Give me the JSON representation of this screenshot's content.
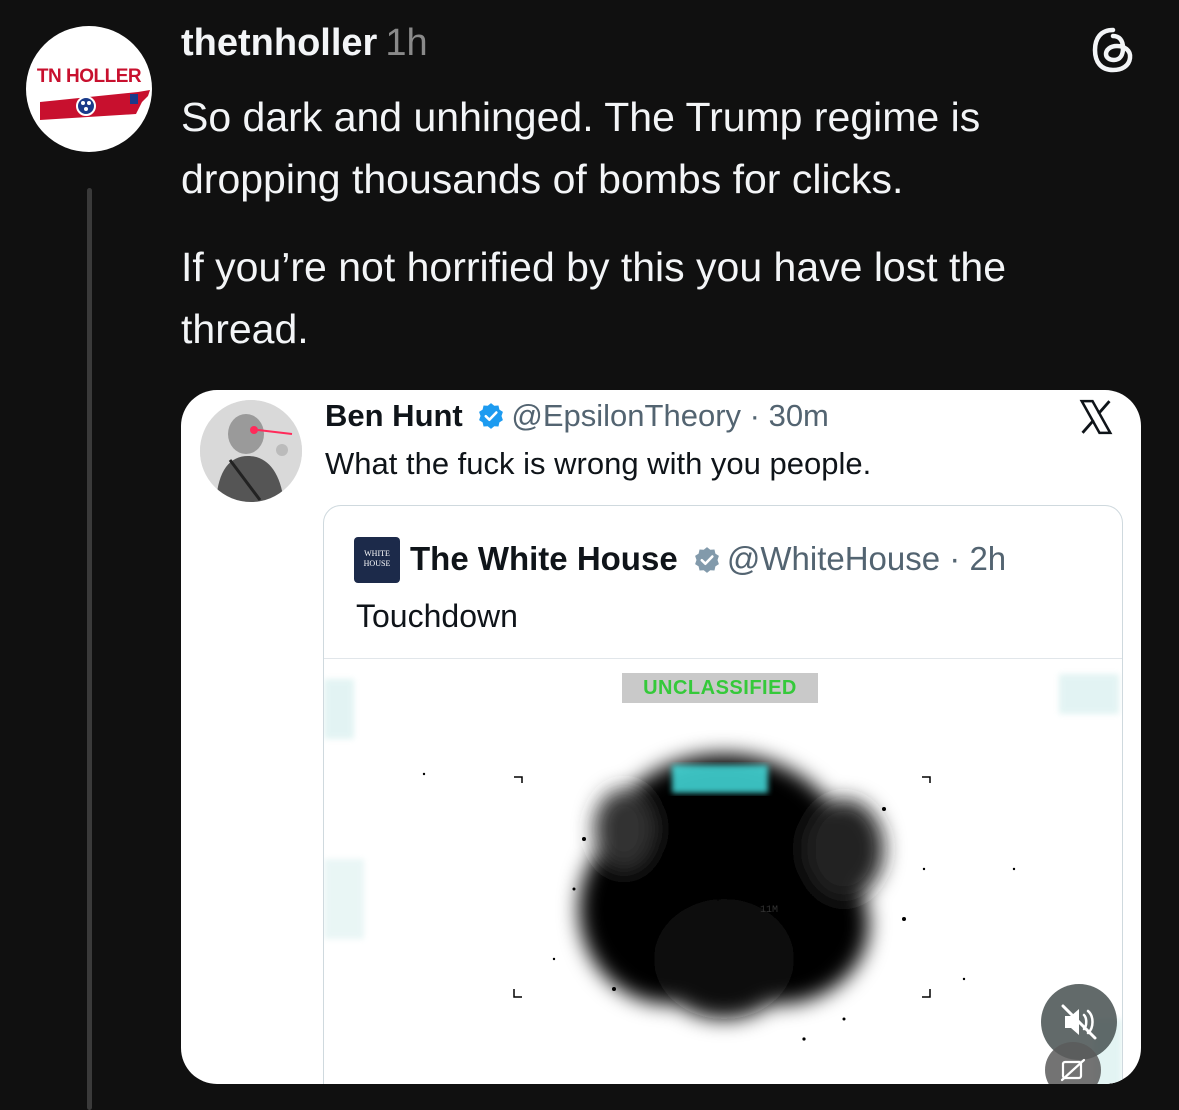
{
  "post": {
    "avatar_label": "TN HOLLER",
    "username": "thetnholler",
    "time": "1h",
    "paragraphs": [
      "So dark and unhinged. The Trump regime is dropping thousands of bombs for clicks.",
      "If you’re not horrified by this you have lost the thread."
    ]
  },
  "embed": {
    "name": "Ben Hunt",
    "handle": "@EpsilonTheory",
    "time": "30m",
    "text": "What the fuck is wrong with you people.",
    "quote": {
      "logo_text": "WHITE HOUSE",
      "name": "The White House",
      "handle": "@WhiteHouse",
      "time": "2h",
      "text": "Touchdown",
      "media_label": "UNCLASSIFIED",
      "range_label": "11M"
    }
  },
  "colors": {
    "background": "#101010",
    "verified": "#1d9bf0",
    "logo_red": "#c8102e",
    "overlay_green": "#35c93a"
  }
}
